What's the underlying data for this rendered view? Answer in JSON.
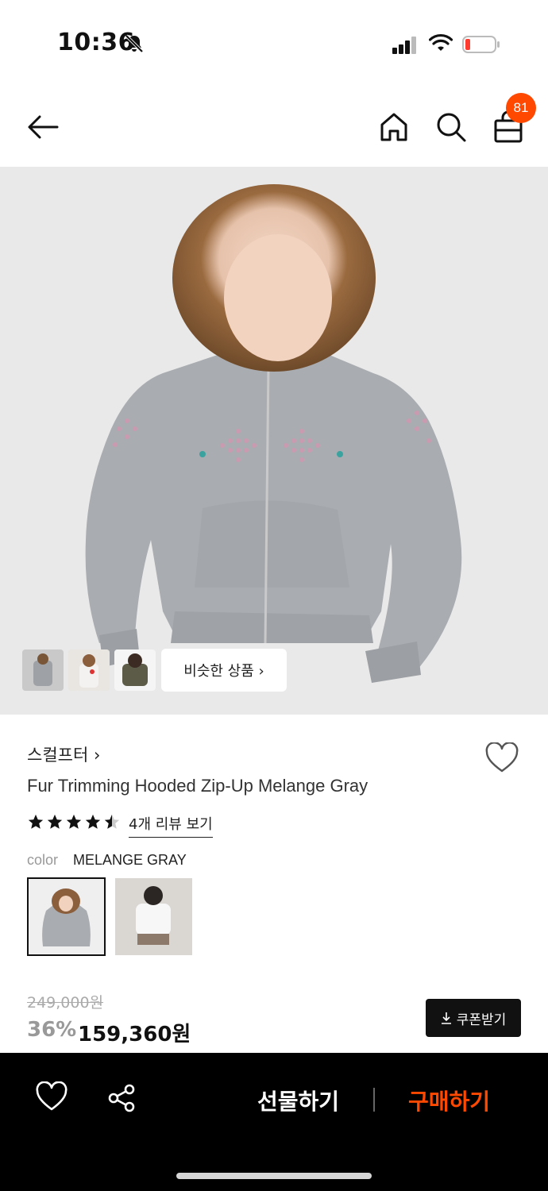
{
  "status": {
    "time": "10:36",
    "icons": [
      "bell-slash-icon",
      "signal-icon",
      "wifi-icon",
      "battery-low-icon"
    ],
    "battery_color": "#ff3b30"
  },
  "header": {
    "icons": [
      "back-arrow-icon",
      "home-icon",
      "search-icon",
      "shopping-bag-icon"
    ],
    "cart_count": "81",
    "badge_color": "#ff4800"
  },
  "gallery": {
    "similar_label": "비슷한 상품 ›"
  },
  "product": {
    "brand": "스컬프터 ›",
    "title": "Fur Trimming Hooded Zip-Up Melange Gray",
    "rating": 4.5,
    "review_link": "4개 리뷰 보기",
    "color_label": "color",
    "color_value": "MELANGE GRAY"
  },
  "price": {
    "original": "249,000원",
    "discount": "36%",
    "sale": "159,360원",
    "coupon_label": "쿠폰받기"
  },
  "bottom_bar": {
    "gift_label": "선물하기",
    "buy_label": "구매하기",
    "accent_color": "#ff4800"
  }
}
